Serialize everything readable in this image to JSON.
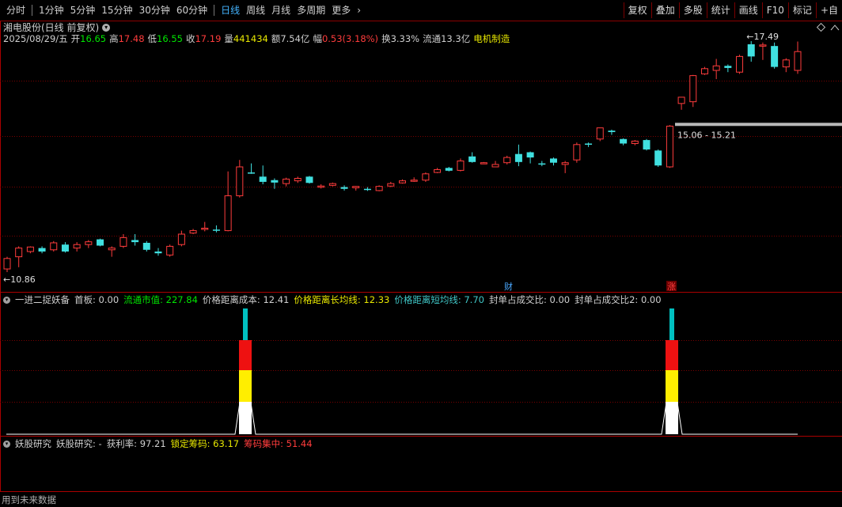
{
  "toolbar": {
    "periods": [
      "分时",
      "1分钟",
      "5分钟",
      "15分钟",
      "30分钟",
      "60分钟",
      "日线",
      "周线",
      "月线",
      "多周期",
      "更多"
    ],
    "active_period": "日线",
    "right_buttons": [
      "复权",
      "叠加",
      "多股",
      "统计",
      "画线",
      "F10",
      "标记",
      "+自"
    ]
  },
  "stock": {
    "title": "湘电股份(日线 前复权)",
    "date": "2025/08/29/五",
    "open_label": "开",
    "open": "16.65",
    "high_label": "高",
    "high": "17.48",
    "low_label": "低",
    "low": "16.55",
    "close_label": "收",
    "close": "17.19",
    "volume_label": "量",
    "volume": "441434",
    "amount_label": "额",
    "amount": "7.54亿",
    "change_label": "幅",
    "change": "0.53(3.18%)",
    "turnover_label": "换",
    "turnover": "3.33%",
    "float_label": "流通",
    "float_cap": "13.3亿",
    "sector": "电机制造"
  },
  "main_chart": {
    "high_marker": "17.49",
    "low_marker": "10.86",
    "price_band_label": "15.06 - 15.21",
    "event_markers": [
      {
        "text": "财",
        "color": "#4aa8ff"
      },
      {
        "text": "涨",
        "color": "#ff4040"
      }
    ],
    "colors": {
      "up": "#ff3c3c",
      "down": "#40e0e0",
      "grid": "#7a0000"
    }
  },
  "chart_data": {
    "type": "candlestick",
    "ylim": [
      10.5,
      17.8
    ],
    "candles": [
      {
        "o": 10.95,
        "h": 11.3,
        "l": 10.86,
        "c": 11.25
      },
      {
        "o": 11.3,
        "h": 11.6,
        "l": 11.0,
        "c": 11.55
      },
      {
        "o": 11.45,
        "h": 11.6,
        "l": 11.4,
        "c": 11.58
      },
      {
        "o": 11.55,
        "h": 11.6,
        "l": 11.4,
        "c": 11.45
      },
      {
        "o": 11.5,
        "h": 11.75,
        "l": 11.45,
        "c": 11.7
      },
      {
        "o": 11.65,
        "h": 11.72,
        "l": 11.42,
        "c": 11.45
      },
      {
        "o": 11.55,
        "h": 11.72,
        "l": 11.45,
        "c": 11.65
      },
      {
        "o": 11.65,
        "h": 11.78,
        "l": 11.55,
        "c": 11.73
      },
      {
        "o": 11.8,
        "h": 11.82,
        "l": 11.6,
        "c": 11.62
      },
      {
        "o": 11.5,
        "h": 11.6,
        "l": 11.3,
        "c": 11.55
      },
      {
        "o": 11.6,
        "h": 11.95,
        "l": 11.55,
        "c": 11.85
      },
      {
        "o": 11.78,
        "h": 11.95,
        "l": 11.62,
        "c": 11.72
      },
      {
        "o": 11.7,
        "h": 11.75,
        "l": 11.45,
        "c": 11.5
      },
      {
        "o": 11.45,
        "h": 11.55,
        "l": 11.33,
        "c": 11.4
      },
      {
        "o": 11.35,
        "h": 11.65,
        "l": 11.3,
        "c": 11.6
      },
      {
        "o": 11.65,
        "h": 12.05,
        "l": 11.6,
        "c": 11.95
      },
      {
        "o": 11.98,
        "h": 12.1,
        "l": 11.95,
        "c": 12.05
      },
      {
        "o": 12.1,
        "h": 12.3,
        "l": 12.03,
        "c": 12.12
      },
      {
        "o": 12.08,
        "h": 12.2,
        "l": 12.0,
        "c": 12.05
      },
      {
        "o": 12.05,
        "h": 13.75,
        "l": 12.03,
        "c": 13.05
      },
      {
        "o": 13.05,
        "h": 14.08,
        "l": 13.0,
        "c": 13.88
      },
      {
        "o": 13.72,
        "h": 13.98,
        "l": 13.68,
        "c": 13.7
      },
      {
        "o": 13.6,
        "h": 13.92,
        "l": 13.38,
        "c": 13.45
      },
      {
        "o": 13.5,
        "h": 13.55,
        "l": 13.25,
        "c": 13.43
      },
      {
        "o": 13.4,
        "h": 13.57,
        "l": 13.32,
        "c": 13.53
      },
      {
        "o": 13.48,
        "h": 13.6,
        "l": 13.42,
        "c": 13.55
      },
      {
        "o": 13.6,
        "h": 13.62,
        "l": 13.4,
        "c": 13.42
      },
      {
        "o": 13.3,
        "h": 13.38,
        "l": 13.26,
        "c": 13.33
      },
      {
        "o": 13.35,
        "h": 13.43,
        "l": 13.32,
        "c": 13.4
      },
      {
        "o": 13.3,
        "h": 13.35,
        "l": 13.2,
        "c": 13.25
      },
      {
        "o": 13.28,
        "h": 13.33,
        "l": 13.2,
        "c": 13.32
      },
      {
        "o": 13.25,
        "h": 13.3,
        "l": 13.19,
        "c": 13.22
      },
      {
        "o": 13.2,
        "h": 13.35,
        "l": 13.18,
        "c": 13.32
      },
      {
        "o": 13.33,
        "h": 13.45,
        "l": 13.3,
        "c": 13.4
      },
      {
        "o": 13.42,
        "h": 13.52,
        "l": 13.4,
        "c": 13.48
      },
      {
        "o": 13.48,
        "h": 13.58,
        "l": 13.45,
        "c": 13.5
      },
      {
        "o": 13.5,
        "h": 13.72,
        "l": 13.45,
        "c": 13.68
      },
      {
        "o": 13.72,
        "h": 13.85,
        "l": 13.7,
        "c": 13.8
      },
      {
        "o": 13.85,
        "h": 13.88,
        "l": 13.75,
        "c": 13.77
      },
      {
        "o": 13.78,
        "h": 14.12,
        "l": 13.75,
        "c": 14.05
      },
      {
        "o": 14.18,
        "h": 14.3,
        "l": 14.0,
        "c": 14.02
      },
      {
        "o": 13.98,
        "h": 14.02,
        "l": 13.96,
        "c": 14.0
      },
      {
        "o": 13.88,
        "h": 14.05,
        "l": 13.88,
        "c": 13.95
      },
      {
        "o": 14.0,
        "h": 14.2,
        "l": 13.95,
        "c": 14.15
      },
      {
        "o": 14.25,
        "h": 14.52,
        "l": 13.9,
        "c": 14.02
      },
      {
        "o": 14.3,
        "h": 14.32,
        "l": 13.98,
        "c": 14.15
      },
      {
        "o": 13.98,
        "h": 14.05,
        "l": 13.9,
        "c": 13.95
      },
      {
        "o": 14.12,
        "h": 14.15,
        "l": 13.92,
        "c": 14.0
      },
      {
        "o": 13.95,
        "h": 14.05,
        "l": 13.7,
        "c": 14.0
      },
      {
        "o": 14.08,
        "h": 14.58,
        "l": 14.0,
        "c": 14.52
      },
      {
        "o": 14.55,
        "h": 14.58,
        "l": 14.45,
        "c": 14.52
      },
      {
        "o": 14.68,
        "h": 14.88,
        "l": 14.62,
        "c": 15.0
      },
      {
        "o": 14.92,
        "h": 14.95,
        "l": 14.8,
        "c": 14.88
      },
      {
        "o": 14.68,
        "h": 14.7,
        "l": 14.5,
        "c": 14.55
      },
      {
        "o": 14.55,
        "h": 14.65,
        "l": 14.5,
        "c": 14.62
      },
      {
        "o": 14.65,
        "h": 14.68,
        "l": 14.35,
        "c": 14.38
      },
      {
        "o": 14.35,
        "h": 14.38,
        "l": 13.88,
        "c": 13.92
      },
      {
        "o": 13.88,
        "h": 15.08,
        "l": 13.85,
        "c": 15.05
      },
      {
        "o": 15.7,
        "h": 15.88,
        "l": 15.52,
        "c": 15.88
      },
      {
        "o": 15.75,
        "h": 16.52,
        "l": 15.6,
        "c": 16.5
      },
      {
        "o": 16.55,
        "h": 16.75,
        "l": 16.52,
        "c": 16.7
      },
      {
        "o": 16.65,
        "h": 16.98,
        "l": 16.4,
        "c": 16.78
      },
      {
        "o": 16.78,
        "h": 16.82,
        "l": 16.6,
        "c": 16.72
      },
      {
        "o": 16.6,
        "h": 17.1,
        "l": 16.55,
        "c": 17.05
      },
      {
        "o": 17.4,
        "h": 17.49,
        "l": 16.9,
        "c": 17.05
      },
      {
        "o": 17.38,
        "h": 17.45,
        "l": 16.95,
        "c": 17.38
      },
      {
        "o": 17.35,
        "h": 17.45,
        "l": 16.7,
        "c": 16.75
      },
      {
        "o": 16.75,
        "h": 17.0,
        "l": 16.6,
        "c": 16.95
      },
      {
        "o": 16.65,
        "h": 17.48,
        "l": 16.55,
        "c": 17.19
      }
    ]
  },
  "indicator1": {
    "name": "一进二捉妖备",
    "items": [
      {
        "label": "首板: 0.00",
        "color": "#d0d0d0"
      },
      {
        "label": "流通市值: 227.84",
        "color": "#00e600"
      },
      {
        "label": "价格距离成本: 12.41",
        "color": "#d0d0d0"
      },
      {
        "label": "价格距离长均线: 12.33",
        "color": "#e8e800"
      },
      {
        "label": "价格距离短均线: 7.70",
        "color": "#40c8c8"
      },
      {
        "label": "封单占成交比: 0.00",
        "color": "#d0d0d0"
      },
      {
        "label": "封单占成交比2: 0.00",
        "color": "#d0d0d0"
      }
    ],
    "signal_colors": [
      "#ffffff",
      "#ffee00",
      "#ee1111",
      "#00c0c0"
    ]
  },
  "indicator2": {
    "name": "妖股研究",
    "items": [
      {
        "label": "妖股研究: -",
        "color": "#d0d0d0"
      },
      {
        "label": "获利率: 97.21",
        "color": "#d0d0d0"
      },
      {
        "label": "锁定筹码: 63.17",
        "color": "#e8e800"
      },
      {
        "label": "筹码集中: 51.44",
        "color": "#ff3c3c"
      }
    ]
  },
  "footer": "用到未来数据"
}
